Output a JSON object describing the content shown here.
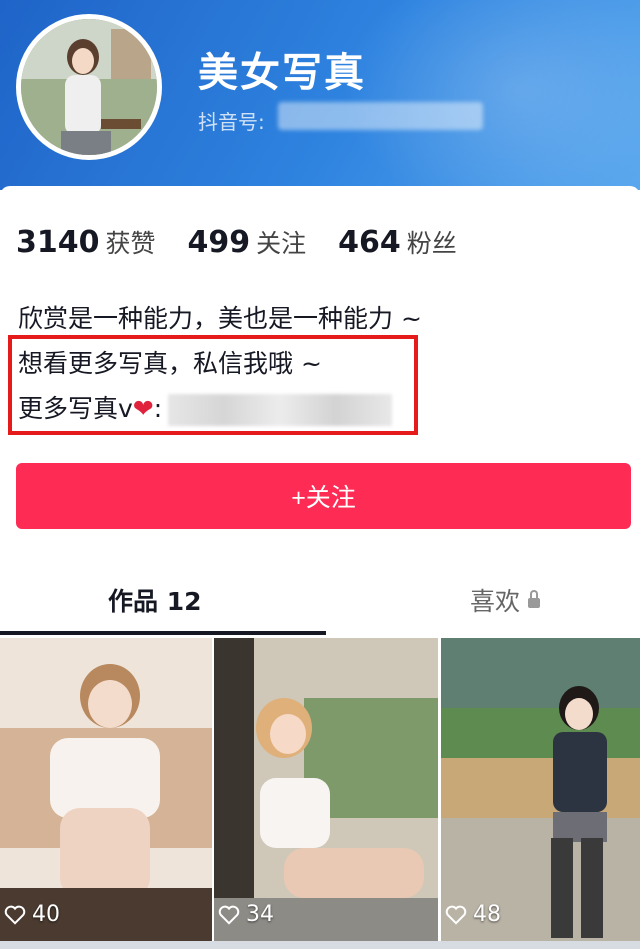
{
  "profile": {
    "name": "美女写真",
    "douyin_id_label": "抖音号:"
  },
  "stats": [
    {
      "value": "3140",
      "label": "获赞"
    },
    {
      "value": "499",
      "label": "关注"
    },
    {
      "value": "464",
      "label": "粉丝"
    }
  ],
  "bio": {
    "line1": "欣赏是一种能力，美也是一种能力 ~",
    "line2": "想看更多写真，私信我哦 ~",
    "line3": "更多写真v",
    "line3_suffix": ":"
  },
  "follow_button": "+关注",
  "tabs": {
    "works": "作品 12",
    "likes": "喜欢"
  },
  "videos": [
    {
      "likes": "40"
    },
    {
      "likes": "34"
    },
    {
      "likes": "48"
    }
  ],
  "colors": {
    "accent": "#fe2c55",
    "header": "#2f84e0",
    "highlight": "#e51b1b"
  }
}
